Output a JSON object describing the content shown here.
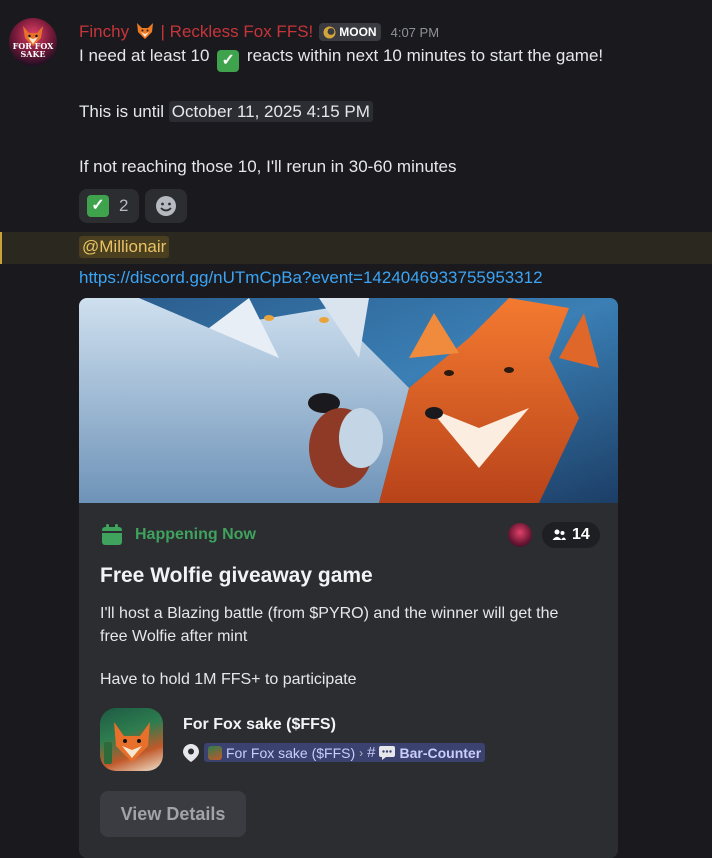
{
  "message": {
    "author": "Finchy",
    "author_suffix": "| Reckless Fox FFS!",
    "avatar_text": "FOR FOX SAKE",
    "badge": "MOON",
    "time": "4:07 PM",
    "line1_pre": "I need at least 10",
    "line1_post": "reacts within next 10 minutes to start the game!",
    "line2_pre": "This is until",
    "timestamp": "October 11, 2025 4:15 PM",
    "line3": "If not reaching those 10, I'll rerun in 30-60 minutes",
    "check_glyph": "✓",
    "reactions": [
      {
        "emoji": "white-check-mark",
        "count": "2"
      }
    ],
    "mention": "@Millionair",
    "link": "https://discord.gg/nUTmCpBa?event=1424046933755953312"
  },
  "event": {
    "status": "Happening Now",
    "interested_count": "14",
    "title": "Free Wolfie giveaway game",
    "description": "I'll host a Blazing battle (from $PYRO) and the winner will get the free Wolfie after mint",
    "requirement": "Have to hold 1M FFS+ to participate",
    "guild_name": "For Fox sake ($FFS)",
    "location_guild": "For Fox sake ($FFS)",
    "channel": "Bar-Counter",
    "hash_glyph": "#",
    "separator": "›",
    "button": "View Details"
  },
  "colors": {
    "author": "#c7343a",
    "link": "#3ba4f5",
    "mention": "#e9c265",
    "status": "#3fa25d",
    "background": "#1a1a1e",
    "card": "#2b2d31"
  }
}
